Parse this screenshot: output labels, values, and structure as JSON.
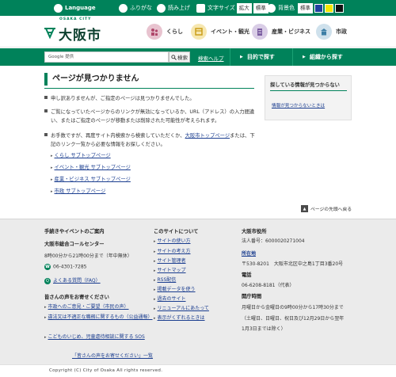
{
  "utility": {
    "language": "Language",
    "furigana": "ふりがな",
    "read_aloud": "読み上げ",
    "text_size": "文字サイズ",
    "text_size_large": "拡大",
    "text_size_standard": "標準",
    "bg_color": "背景色",
    "bg_standard": "標準",
    "colors": {
      "brand": "#00825a",
      "blue": "#1f3f9f",
      "yellow": "#f5e600",
      "black": "#111111"
    }
  },
  "header": {
    "logo_en": "OSAKA CITY",
    "logo_ja": "大阪市",
    "nav": [
      {
        "label": "くらし",
        "icon": "family-icon",
        "color": "#e8c3cf"
      },
      {
        "label": "イベント・観光",
        "icon": "event-icon",
        "color": "#f6e7b0"
      },
      {
        "label": "産業・ビジネス",
        "icon": "building-icon",
        "color": "#d9cde6"
      },
      {
        "label": "市政",
        "icon": "cityhall-icon",
        "color": "#cfe1ec"
      }
    ]
  },
  "navbar": {
    "search_placeholder": "Google 提供",
    "search_button": "検索",
    "search_help": "検索ヘルプ",
    "tab_purpose": "目的で探す",
    "tab_org": "組織から探す"
  },
  "main": {
    "title": "ページが見つかりません",
    "p1": "申し訳ありませんが、ご指定のページは見つかりませんでした。",
    "p2_line1": "ご覧になっていたページからのリンクが無効になっているか、URL（アドレス）の入力間違",
    "p2_line2": "い、またはご指定のページが移動または削除された可能性が考えられます。",
    "p3_pre": "お手数ですが、再度サイト内検索から検索していただくか、",
    "p3_link": "大阪市トップページ",
    "p3_post": "または、下",
    "p3_line2": "記のリンク一覧から必要な情報をお探しください。",
    "links": [
      "くらし サブトップページ",
      "イベント・観光 サブトップページ",
      "産業・ビジネス サブトップページ",
      "市政 サブトップページ"
    ],
    "page_top": "ページの先頭へ戻る"
  },
  "sidebar": {
    "title": "探している情報が見つからない",
    "link": "情報が見つからないときは"
  },
  "footer": {
    "col1": {
      "title": "手続きやイベントのご案内",
      "center": "大阪市総合コールセンター",
      "hours": "8時00分から21時00分まで（年中無休）",
      "phone": "06-4301-7285",
      "faq": "よくある質問（FAQ）",
      "voice_title": "皆さんの声をお寄せください",
      "voice_links": [
        "市政へのご意見・ご要望（市民の声）",
        "違法又は不適正な職務に関するもの（公益通報）",
        "こどものいじめ、児童虐待相談に関する SOS"
      ],
      "voice_more": "「皆さんの声をお寄せください」一覧"
    },
    "col2": {
      "title": "このサイトについて",
      "links": [
        "サイトの使い方",
        "サイトの考え方",
        "サイト管理者",
        "サイトマップ",
        "RSS配信",
        "掲載データを使う",
        "過去のサイト",
        "リニューアルにあたって",
        "表示がくずれるときは"
      ]
    },
    "col3": {
      "title": "大阪市役所",
      "corp_no": "法人番号：6000020271004",
      "location_label": "所在地",
      "address": "〒530-8201　大阪市北区中之島1丁目3番20号",
      "tel_label": "電話",
      "tel": "06-6208-8181（代表）",
      "hours_label": "開庁時間",
      "hours_1": "月曜日から金曜日の9時00分から17時30分まで",
      "hours_2": "（土曜日、日曜日、祝日及び12月29日から翌年",
      "hours_3": "1月3日までは除く）"
    },
    "copyright": "Copyright (C) City of Osaka All rights reserved."
  }
}
